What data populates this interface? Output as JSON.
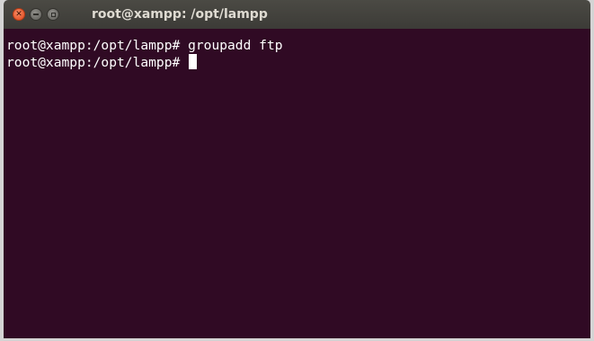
{
  "window": {
    "title": "root@xampp: /opt/lampp",
    "controls": {
      "close_icon": "close-icon",
      "minimize_icon": "minimize-icon",
      "maximize_icon": "maximize-icon",
      "close_glyph": "✕"
    }
  },
  "terminal": {
    "lines": [
      {
        "prompt": "root@xampp:/opt/lampp# ",
        "command": "groupadd ftp"
      },
      {
        "prompt": "root@xampp:/opt/lampp# ",
        "command": ""
      }
    ]
  },
  "colors": {
    "terminal_background": "#300a24",
    "terminal_text": "#ffffff",
    "titlebar": "#3c3b37",
    "title_text": "#dfdbd2",
    "close_button": "#e0461d"
  }
}
